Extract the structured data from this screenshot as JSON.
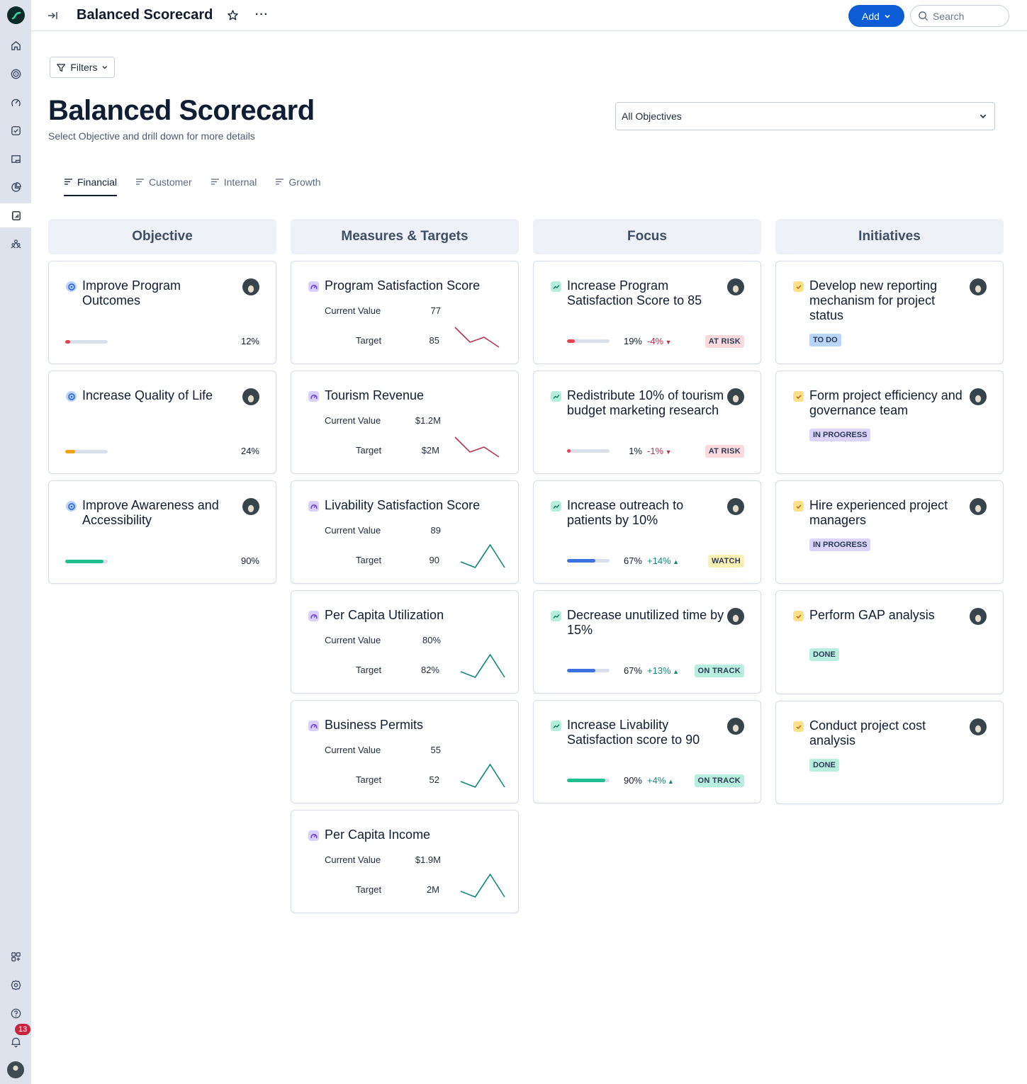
{
  "app": {
    "title": "Balanced Scorecard",
    "add_label": "Add",
    "search_placeholder": "Search",
    "notification_count": "13"
  },
  "sidebar": {
    "items": [
      {
        "name": "home",
        "icon": "home-icon"
      },
      {
        "name": "goals",
        "icon": "target-icon"
      },
      {
        "name": "dashboards",
        "icon": "gauge-icon"
      },
      {
        "name": "tasks",
        "icon": "checkbox-icon"
      },
      {
        "name": "boards",
        "icon": "screen-icon"
      },
      {
        "name": "reports",
        "icon": "pie-chart-icon"
      },
      {
        "name": "scorecards",
        "icon": "scorecard-icon",
        "active": true
      },
      {
        "name": "teams",
        "icon": "people-icon"
      }
    ],
    "bottom": [
      {
        "name": "apps",
        "icon": "apps-add-icon"
      },
      {
        "name": "settings",
        "icon": "gear-icon"
      },
      {
        "name": "help",
        "icon": "help-icon"
      },
      {
        "name": "notifications",
        "icon": "bell-icon"
      }
    ]
  },
  "page": {
    "filters_label": "Filters",
    "title": "Balanced Scorecard",
    "subtitle": "Select Objective and drill down for more details",
    "objective_select": "All Objectives",
    "tabs": [
      {
        "label": "Financial",
        "active": true
      },
      {
        "label": "Customer"
      },
      {
        "label": "Internal"
      },
      {
        "label": "Growth"
      }
    ]
  },
  "columns": {
    "objective": "Objective",
    "measures": "Measures & Targets",
    "focus": "Focus",
    "initiatives": "Initiatives"
  },
  "objectives": [
    {
      "title": "Improve Program Outcomes",
      "progress": 12,
      "progress_label": "12%",
      "color": "#e0434f"
    },
    {
      "title": "Increase Quality of Life",
      "progress": 24,
      "progress_label": "24%",
      "color": "#f0a30a"
    },
    {
      "title": "Improve Awareness and Accessibility",
      "progress": 90,
      "progress_label": "90%",
      "color": "#1fbf8f"
    }
  ],
  "measures": {
    "current_label": "Current Value",
    "target_label": "Target",
    "items": [
      {
        "title": "Program Satisfaction Score",
        "current": "77",
        "target": "85",
        "trend": "down",
        "spark": [
          4,
          1,
          2,
          0
        ]
      },
      {
        "title": "Tourism Revenue",
        "current": "$1.2M",
        "target": "$2M",
        "trend": "down",
        "spark": [
          4,
          1,
          2,
          0
        ]
      },
      {
        "title": "Livability Satisfaction Score",
        "current": "89",
        "target": "90",
        "trend": "up",
        "spark": [
          1,
          0,
          4,
          0
        ]
      },
      {
        "title": "Per Capita Utilization",
        "current": "80%",
        "target": "82%",
        "trend": "up",
        "spark": [
          1,
          0,
          4,
          0
        ]
      },
      {
        "title": "Business Permits",
        "current": "55",
        "target": "52",
        "trend": "up",
        "spark": [
          1,
          0,
          4,
          0
        ]
      },
      {
        "title": "Per Capita Income",
        "current": "$1.9M",
        "target": "2M",
        "trend": "up",
        "spark": [
          1,
          0,
          4,
          0
        ]
      }
    ]
  },
  "focus": [
    {
      "title": "Increase Program Satisfaction Score to 85",
      "progress": 19,
      "progress_label": "19%",
      "delta": "-4%",
      "direction": "down",
      "status": "AT RISK",
      "bar_color": "#e0434f",
      "status_bg": "#fcd9dc"
    },
    {
      "title": "Redistribute 10% of tourism budget marketing research",
      "progress": 1,
      "progress_label": "1%",
      "delta": "-1%",
      "direction": "down",
      "status": "AT RISK",
      "bar_color": "#e0434f",
      "status_bg": "#fcd9dc"
    },
    {
      "title": "Increase outreach to patients by 10%",
      "progress": 67,
      "progress_label": "67%",
      "delta": "+14%",
      "direction": "up",
      "status": "WATCH",
      "bar_color": "#3d72e0",
      "status_bg": "#fdf0b3"
    },
    {
      "title": "Decrease unutilized time by 15%",
      "progress": 67,
      "progress_label": "67%",
      "delta": "+13%",
      "direction": "up",
      "status": "ON TRACK",
      "bar_color": "#3d72e0",
      "status_bg": "#b8eedd"
    },
    {
      "title": "Increase Livability Satisfaction score to 90",
      "progress": 90,
      "progress_label": "90%",
      "delta": "+4%",
      "direction": "up",
      "status": "ON TRACK",
      "bar_color": "#1fbf8f",
      "status_bg": "#b8eedd"
    }
  ],
  "initiatives": [
    {
      "title": "Develop new reporting mechanism for project status",
      "status": "TO DO",
      "status_bg": "#b8d5fb"
    },
    {
      "title": "Form project efficiency and governance team",
      "status": "IN PROGRESS",
      "status_bg": "#dcd4fb"
    },
    {
      "title": "Hire experienced project managers",
      "status": "IN PROGRESS",
      "status_bg": "#dcd4fb"
    },
    {
      "title": "Perform GAP analysis",
      "status": "DONE",
      "status_bg": "#b8eedd"
    },
    {
      "title": "Conduct project cost analysis",
      "status": "DONE",
      "status_bg": "#b8eedd"
    }
  ],
  "colors": {
    "accent": "#0b5cd5",
    "down": "#b8344f",
    "up": "#13877a"
  }
}
